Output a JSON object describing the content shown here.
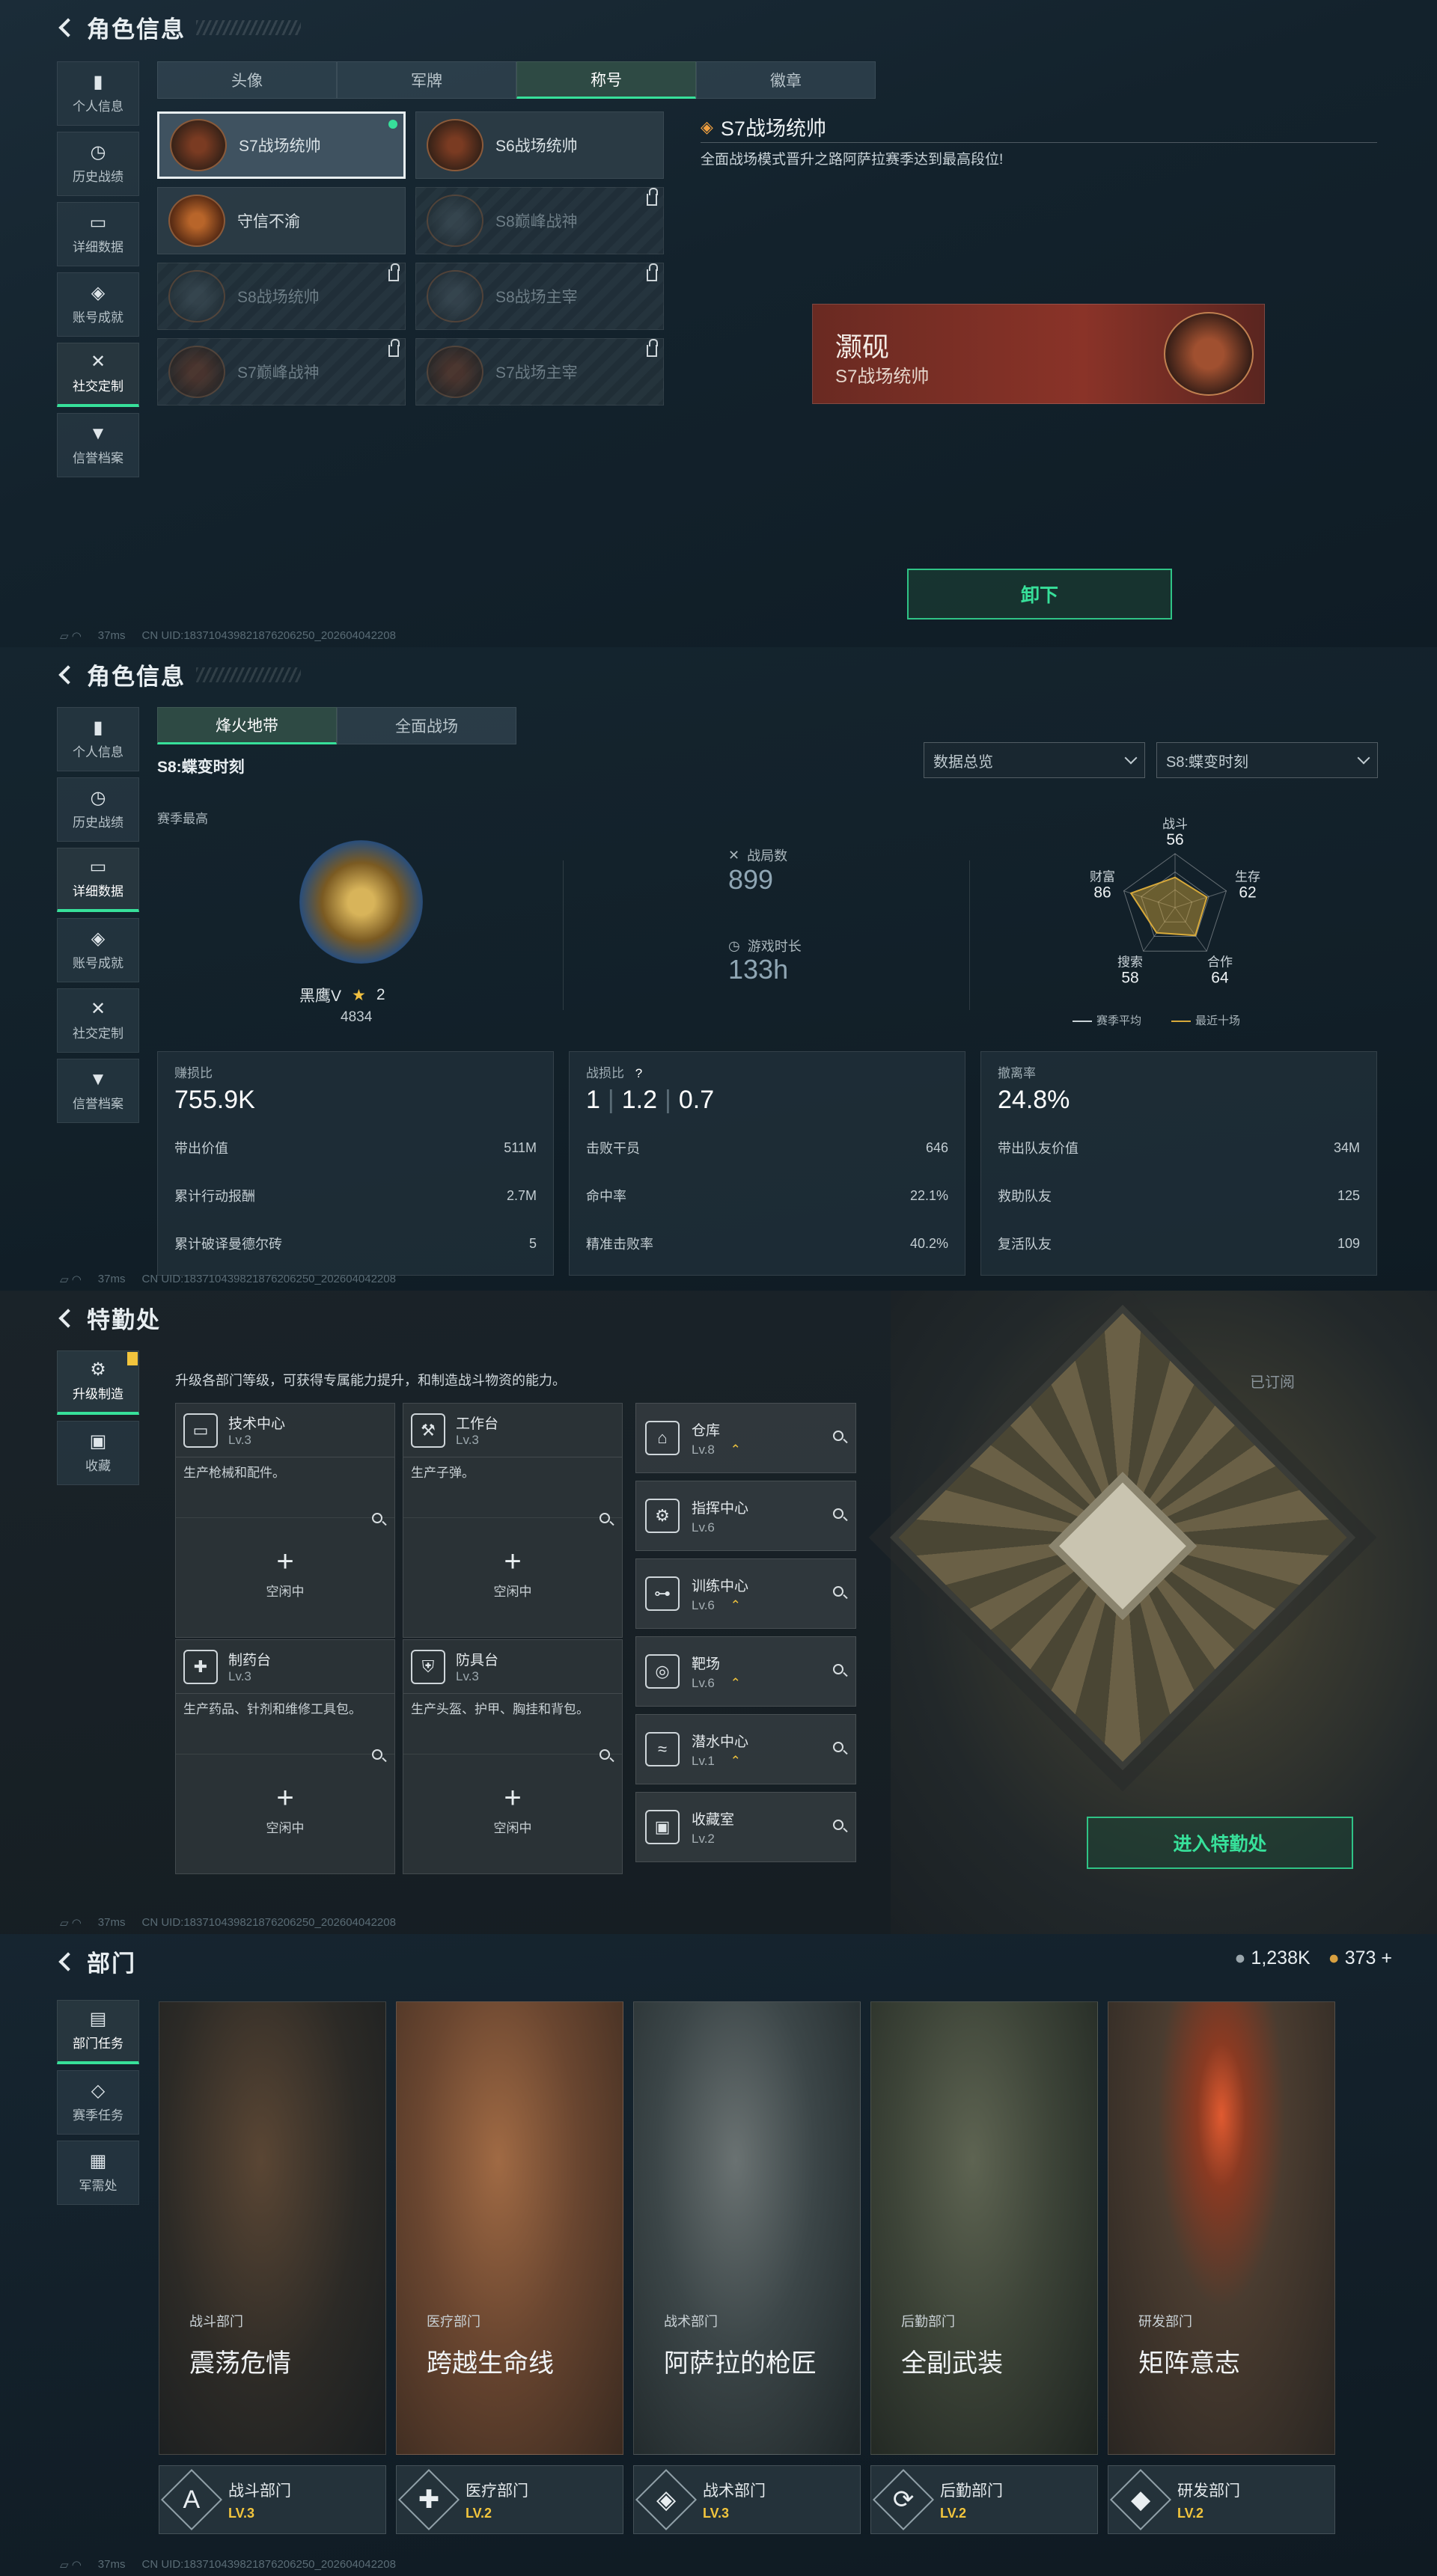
{
  "status": {
    "ping": "37ms",
    "uid": "CN UID:183710439821876206250_202604042208"
  },
  "panel1": {
    "title": "角色信息",
    "nav": [
      "个人信息",
      "历史战绩",
      "详细数据",
      "账号成就",
      "社交定制",
      "信誉档案"
    ],
    "tabs": [
      "头像",
      "军牌",
      "称号",
      "徽章"
    ],
    "titles": [
      {
        "name": "S7战场统帅",
        "state": "selected"
      },
      {
        "name": "S6战场统帅",
        "state": "owned"
      },
      {
        "name": "守信不渝",
        "state": "owned"
      },
      {
        "name": "S8巅峰战神",
        "state": "locked"
      },
      {
        "name": "S8战场统帅",
        "state": "locked"
      },
      {
        "name": "S8战场主宰",
        "state": "locked"
      },
      {
        "name": "S7巅峰战神",
        "state": "locked"
      },
      {
        "name": "S7战场主宰",
        "state": "locked"
      }
    ],
    "detail_title": "S7战场统帅",
    "detail_desc": "全面战场模式晋升之路阿萨拉赛季达到最高段位!",
    "preview_name": "灏砚",
    "preview_title": "S7战场统帅",
    "unequip": "卸下"
  },
  "panel2": {
    "title": "角色信息",
    "nav": [
      "个人信息",
      "历史战绩",
      "详细数据",
      "账号成就",
      "社交定制",
      "信誉档案"
    ],
    "modes": [
      "烽火地带",
      "全面战场"
    ],
    "season": "S8:蝶变时刻",
    "dropdown1": "数据总览",
    "dropdown2": "S8:蝶变时刻",
    "season_best": "赛季最高",
    "rank_name": "黑鹰V",
    "rank_stars": "2",
    "rank_score": "4834",
    "matches_label": "战局数",
    "matches": "899",
    "playtime_label": "游戏时长",
    "playtime": "133h",
    "radar": {
      "axes": [
        {
          "label": "战斗",
          "value": "56",
          "v": 56
        },
        {
          "label": "生存",
          "value": "62",
          "v": 62
        },
        {
          "label": "合作",
          "value": "64",
          "v": 64
        },
        {
          "label": "搜索",
          "value": "58",
          "v": 58
        },
        {
          "label": "财富",
          "value": "86",
          "v": 86
        }
      ],
      "legend_avg": "赛季平均",
      "legend_recent": "最近十场"
    },
    "cards": [
      {
        "label": "赚损比",
        "big": "755.9K",
        "rows": [
          [
            "带出价值",
            "511M"
          ],
          [
            "累计行动报酬",
            "2.7M"
          ],
          [
            "累计破译曼德尔砖",
            "5"
          ]
        ]
      },
      {
        "label": "战损比",
        "hint": "?",
        "big_parts": [
          "1",
          "1.2",
          "0.7"
        ],
        "rows": [
          [
            "击败干员",
            "646"
          ],
          [
            "命中率",
            "22.1%"
          ],
          [
            "精准击败率",
            "40.2%"
          ]
        ]
      },
      {
        "label": "撤离率",
        "big": "24.8%",
        "rows": [
          [
            "带出队友价值",
            "34M"
          ],
          [
            "救助队友",
            "125"
          ],
          [
            "复活队友",
            "109"
          ]
        ]
      }
    ]
  },
  "panel3": {
    "title": "特勤处",
    "nav": [
      "升级制造",
      "收藏"
    ],
    "intro": "升级各部门等级，可获得专属能力提升，和制造战斗物资的能力。",
    "subscribed": "已订阅",
    "idle": "空闲中",
    "big": [
      {
        "name": "技术中心",
        "lv": "Lv.3",
        "desc": "生产枪械和配件。",
        "icon": "monitor-icon"
      },
      {
        "name": "工作台",
        "lv": "Lv.3",
        "desc": "生产子弹。",
        "icon": "hammer-icon"
      },
      {
        "name": "制药台",
        "lv": "Lv.3",
        "desc": "生产药品、针剂和维修工具包。",
        "icon": "medicine-icon"
      },
      {
        "name": "防具台",
        "lv": "Lv.3",
        "desc": "生产头盔、护甲、胸挂和背包。",
        "icon": "armor-icon"
      }
    ],
    "small": [
      {
        "name": "仓库",
        "lv": "Lv.8",
        "up": true
      },
      {
        "name": "指挥中心",
        "lv": "Lv.6",
        "up": false
      },
      {
        "name": "训练中心",
        "lv": "Lv.6",
        "up": true
      },
      {
        "name": "靶场",
        "lv": "Lv.6",
        "up": true
      },
      {
        "name": "潜水中心",
        "lv": "Lv.1",
        "up": true
      },
      {
        "name": "收藏室",
        "lv": "Lv.2",
        "up": false
      }
    ],
    "enter": "进入特勤处"
  },
  "panel4": {
    "title": "部门",
    "currency1": "1,238K",
    "currency2": "373",
    "nav": [
      "部门任务",
      "赛季任务",
      "军需处"
    ],
    "depts": [
      {
        "cat": "战斗部门",
        "name": "震荡危情",
        "label": "战斗部门",
        "lv": "LV.3",
        "color": "#4a3a2a"
      },
      {
        "cat": "医疗部门",
        "name": "跨越生命线",
        "label": "医疗部门",
        "lv": "LV.2",
        "color": "#6a4630"
      },
      {
        "cat": "战术部门",
        "name": "阿萨拉的枪匠",
        "label": "战术部门",
        "lv": "LV.3",
        "color": "#3c4648"
      },
      {
        "cat": "后勤部门",
        "name": "全副武装",
        "label": "后勤部门",
        "lv": "LV.2",
        "color": "#3d4438"
      },
      {
        "cat": "研发部门",
        "name": "矩阵意志",
        "label": "研发部门",
        "lv": "LV.2",
        "color": "#4a3c30"
      }
    ]
  }
}
